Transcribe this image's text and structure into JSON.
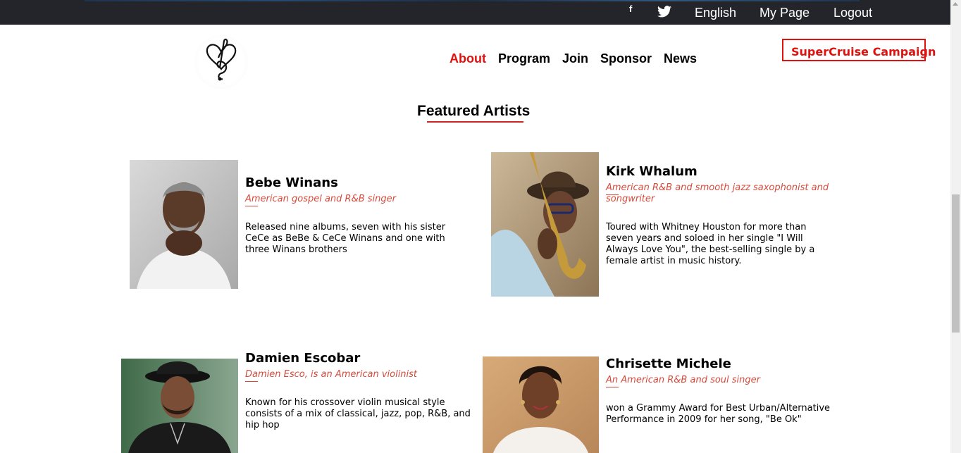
{
  "topbar": {
    "facebook_icon": "f",
    "twitter_icon": "twitter-icon",
    "language": "English",
    "my_page": "My Page",
    "logout": "Logout"
  },
  "header": {
    "logo_icon": "heart-treble-clef-logo",
    "nav": {
      "about": "About",
      "program": "Program",
      "join": "Join",
      "sponsor": "Sponsor",
      "news": "News"
    },
    "campaign_button": "SuperCruise Campaign"
  },
  "section": {
    "title": "Featured Artists"
  },
  "artists": [
    {
      "name": "Bebe Winans",
      "role": "American gospel and R&B singer",
      "description": "Released nine albums, seven with his sister CeCe as BeBe & CeCe Winans and one with three Winans brothers"
    },
    {
      "name": "Kirk Whalum",
      "role": "American R&B and smooth jazz saxophonist and songwriter",
      "description": "Toured with Whitney Houston for more than seven years and soloed in her single \"I Will Always Love You\", the best-selling single by a female artist in music history."
    },
    {
      "name": "Damien Escobar",
      "role": "Damien Esco, is an American violinist",
      "description": "Known for his crossover violin musical style consists of a mix of classical, jazz, pop, R&B, and hip hop"
    },
    {
      "name": "Chrisette Michele",
      "role": "An American R&B and soul singer",
      "description": "won a Grammy Award for Best Urban/Alternative Performance in 2009 for her song, \"Be Ok\""
    }
  ],
  "colors": {
    "accent": "#e0120f",
    "topbar_bg": "#23252b",
    "role_text": "#d64a3c"
  }
}
